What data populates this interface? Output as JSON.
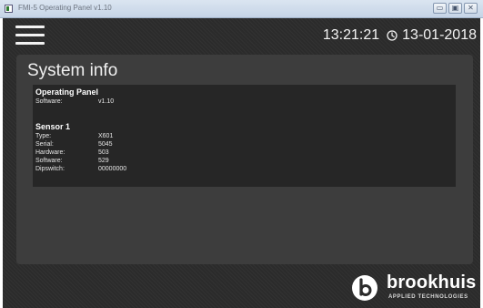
{
  "window": {
    "title": "FMI-5 Operating Panel v1.10",
    "controls": {
      "minimize": "▭",
      "maximize": "▣",
      "close": "✕"
    }
  },
  "header": {
    "time": "13:21:21",
    "date": "13-01-2018",
    "icons": {
      "menu": "hamburger-menu-icon",
      "clock": "clock-icon"
    }
  },
  "panel": {
    "title": "System info",
    "operating_panel": {
      "heading": "Operating Panel",
      "rows": [
        {
          "label": "Software:",
          "value": "v1.10"
        }
      ]
    },
    "sensor": {
      "heading": "Sensor 1",
      "rows": [
        {
          "label": "Type:",
          "value": "X601"
        },
        {
          "label": "Serial:",
          "value": "5045"
        },
        {
          "label": "Hardware:",
          "value": "503"
        },
        {
          "label": "Software:",
          "value": "529"
        },
        {
          "label": "Dipswitch:",
          "value": "00000000"
        }
      ]
    }
  },
  "logo": {
    "name": "brookhuis",
    "tagline": "APPLIED TECHNOLOGIES"
  },
  "colors": {
    "background": "#2b2b2b",
    "panel": "#3d3d3d",
    "info_box": "#262626",
    "text": "#ffffff"
  }
}
